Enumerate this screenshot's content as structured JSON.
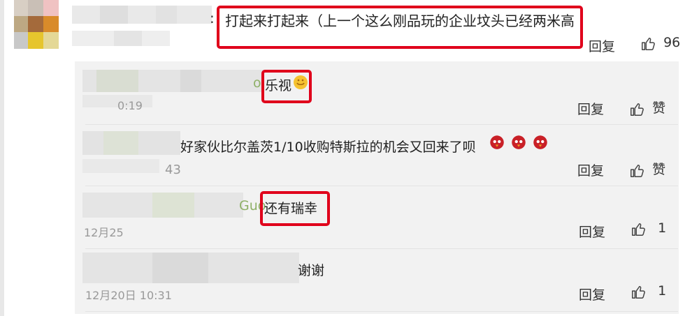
{
  "main_comment": {
    "separator": ":",
    "text": "打起来打起来（上一个这么刚品玩的企业坟头已经两米高",
    "reply_label": "回复",
    "like_count": "96"
  },
  "replies": [
    {
      "text": "乐视",
      "prefix_partial": "o",
      "timestamp_partial": "0:19",
      "reply_label": "回复",
      "like_label": "赞"
    },
    {
      "text": "好家伙比尔盖茨1/10收购特斯拉的机会又回来了呗",
      "timestamp_partial": "43",
      "reply_label": "回复",
      "like_label": "赞"
    },
    {
      "prefix_partial": "Guo",
      "text": "还有瑞幸",
      "timestamp_partial": "12月25",
      "reply_label": "回复",
      "like_count": "1"
    },
    {
      "text": "谢谢",
      "timestamp_partial": "12月20日 10:31",
      "reply_label": "回复",
      "like_count": "1"
    }
  ],
  "colors": {
    "highlight_border": "#e0001b",
    "reply_bg": "#f2f2f2",
    "username_green": "#7aa64e"
  },
  "icons": [
    "thumbs-up-icon",
    "angry-bird-emoji",
    "smile-emoji"
  ]
}
